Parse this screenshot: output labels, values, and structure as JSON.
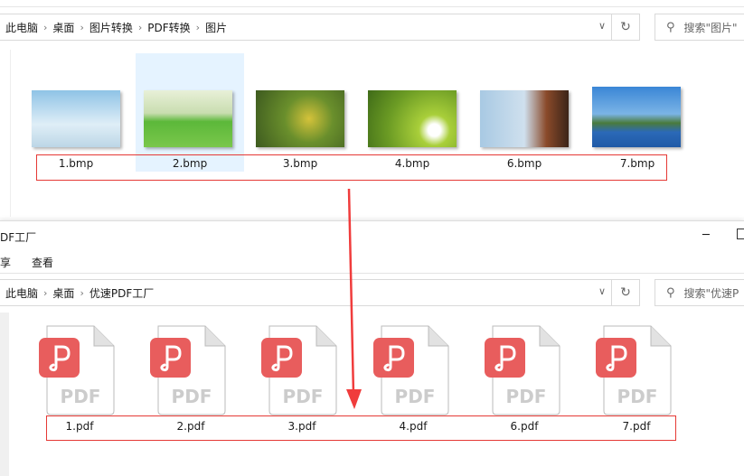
{
  "top_window": {
    "breadcrumb": [
      "此电脑",
      "桌面",
      "图片转换",
      "PDF转换",
      "图片"
    ],
    "search_placeholder": "搜索\"图片\"",
    "files": [
      "1.bmp",
      "2.bmp",
      "3.bmp",
      "4.bmp",
      "6.bmp",
      "7.bmp"
    ],
    "selected_index": 1
  },
  "bottom_window": {
    "title": "DF工厂",
    "menu": [
      "享",
      "查看"
    ],
    "breadcrumb": [
      "此电脑",
      "桌面",
      "优速PDF工厂"
    ],
    "search_placeholder": "搜索\"优速P",
    "files": [
      "1.pdf",
      "2.pdf",
      "3.pdf",
      "4.pdf",
      "6.pdf",
      "7.pdf"
    ],
    "pdf_icon_text": "PDF"
  },
  "colors": {
    "annotation": "#e53935",
    "pdf_brand": "#e85d5d",
    "selection": "#e5f3ff"
  }
}
